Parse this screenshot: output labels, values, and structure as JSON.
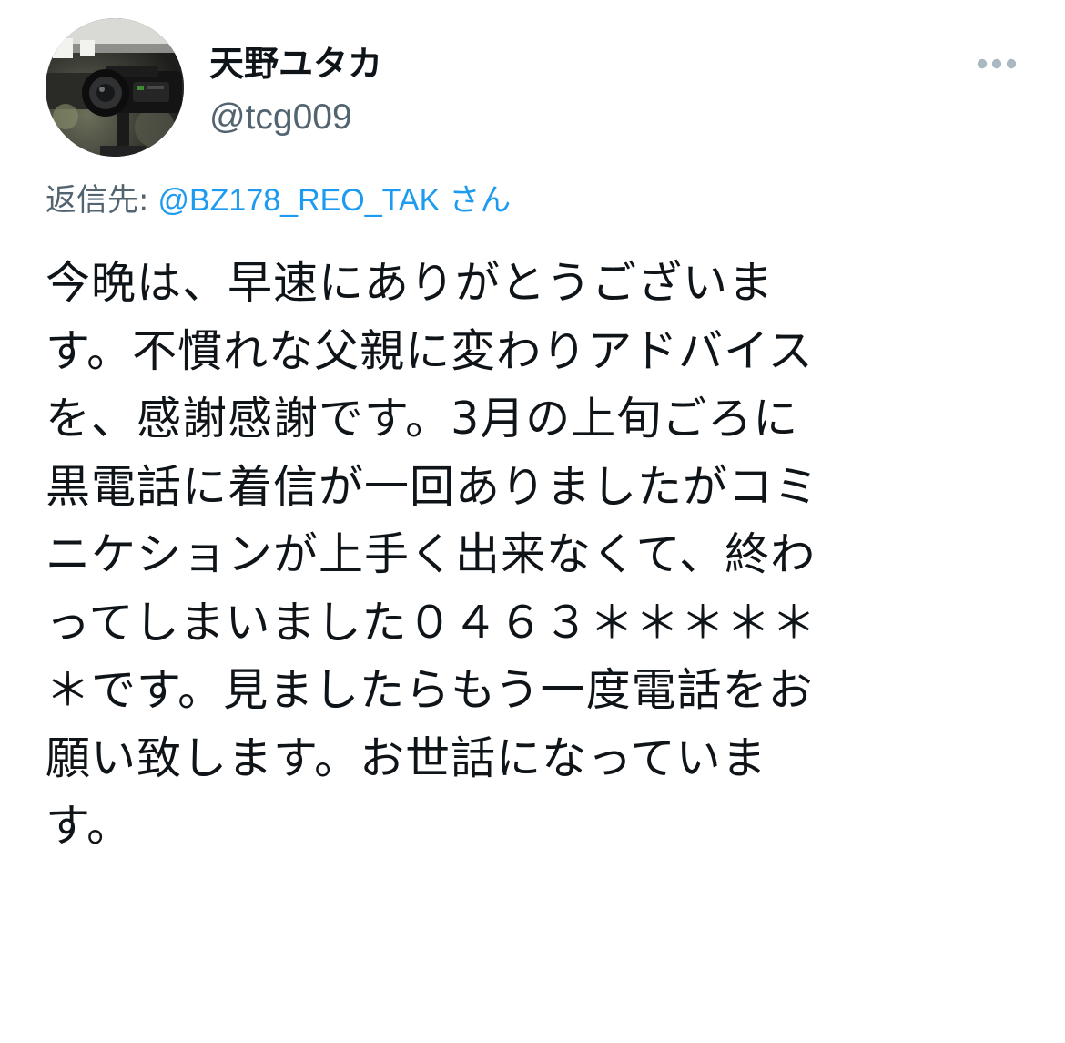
{
  "user": {
    "display_name": "天野ユタカ",
    "handle": "@tcg009",
    "avatar": "camera-photo-avatar"
  },
  "more_icon": "more-options-icon",
  "reply": {
    "label": "返信先:",
    "handle": "@BZ178_REO_TAK",
    "suffix": "さん"
  },
  "tweet": {
    "lines": [
      "今晩は、早速にありがとうございま",
      "す。不慣れな父親に変わりアドバイス",
      "を、感謝感謝です。3月の上旬ごろに",
      "黒電話に着信が一回ありましたがコミ",
      "ニケションが上手く出来なくて、終わ",
      "ってしまいました０４６３＊＊＊＊＊",
      "＊です。見ましたらもう一度電話をお",
      "願い致します。お世話になっていま",
      "す。"
    ]
  },
  "colors": {
    "text": "#0f1419",
    "secondary": "#536471",
    "link": "#1d9bf0",
    "icon": "#aab8c2"
  }
}
